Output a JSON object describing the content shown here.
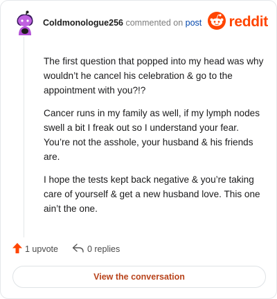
{
  "comment": {
    "username": "Coldmonologue256",
    "action_text": "commented on",
    "post_link": "post",
    "paragraphs": [
      "The first question that popped into my head was why wouldn’t he cancel his celebration & go to the appointment with you?!?",
      "Cancer runs in my family as well, if my lymph nodes swell a bit I freak out so I understand your fear. You’re not the asshole, your husband & his friends are.",
      "I hope the tests kept back negative & you’re taking care of yourself & get a new husband love. This one ain’t the one."
    ]
  },
  "brand": {
    "name": "reddit",
    "color": "#ff4500"
  },
  "actions": {
    "upvote_label": "1 upvote",
    "replies_label": "0 replies"
  },
  "cta": {
    "label": "View the conversation"
  },
  "icons": {
    "upvote": "upvote-arrow-icon",
    "reply": "reply-arrow-icon",
    "brand": "reddit-snoo-icon",
    "avatar": "snoo-avatar-icon"
  }
}
